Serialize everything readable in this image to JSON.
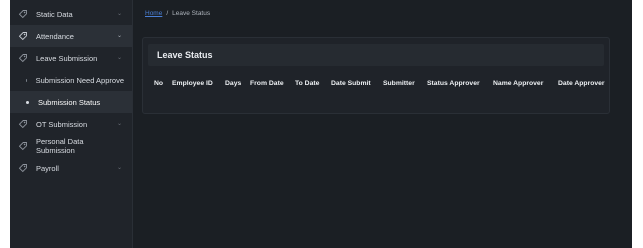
{
  "sidebar": {
    "items": [
      {
        "label": "Static Data",
        "icon": "tag-icon",
        "type": "parent",
        "expanded": false
      },
      {
        "label": "Attendance",
        "icon": "tag-icon",
        "type": "parent",
        "expanded": true
      },
      {
        "label": "Leave Submission",
        "icon": "tag-icon",
        "type": "parent",
        "expanded": false
      },
      {
        "label": "Submission Need Approve",
        "type": "child",
        "active": false
      },
      {
        "label": "Submission Status",
        "type": "child",
        "active": true
      },
      {
        "label": "OT Submission",
        "icon": "tag-icon",
        "type": "parent",
        "expanded": false
      },
      {
        "label": "Personal Data Submission",
        "icon": "tag-icon",
        "type": "parent",
        "expanded": false
      },
      {
        "label": "Payroll",
        "icon": "tag-icon",
        "type": "parent",
        "expanded": false
      }
    ]
  },
  "breadcrumb": {
    "home": "Home",
    "separator": "/",
    "current": "Leave Status"
  },
  "card": {
    "title": "Leave Status",
    "columns": [
      "No",
      "Employee ID",
      "Days",
      "From Date",
      "To Date",
      "Date Submit",
      "Submitter",
      "Status Approver",
      "Name Approver",
      "Date Approver"
    ],
    "rows": []
  },
  "colors": {
    "background": "#1b1f24",
    "sidebar": "#20242a",
    "link": "#4a7fd6",
    "active": "#2b3037"
  }
}
